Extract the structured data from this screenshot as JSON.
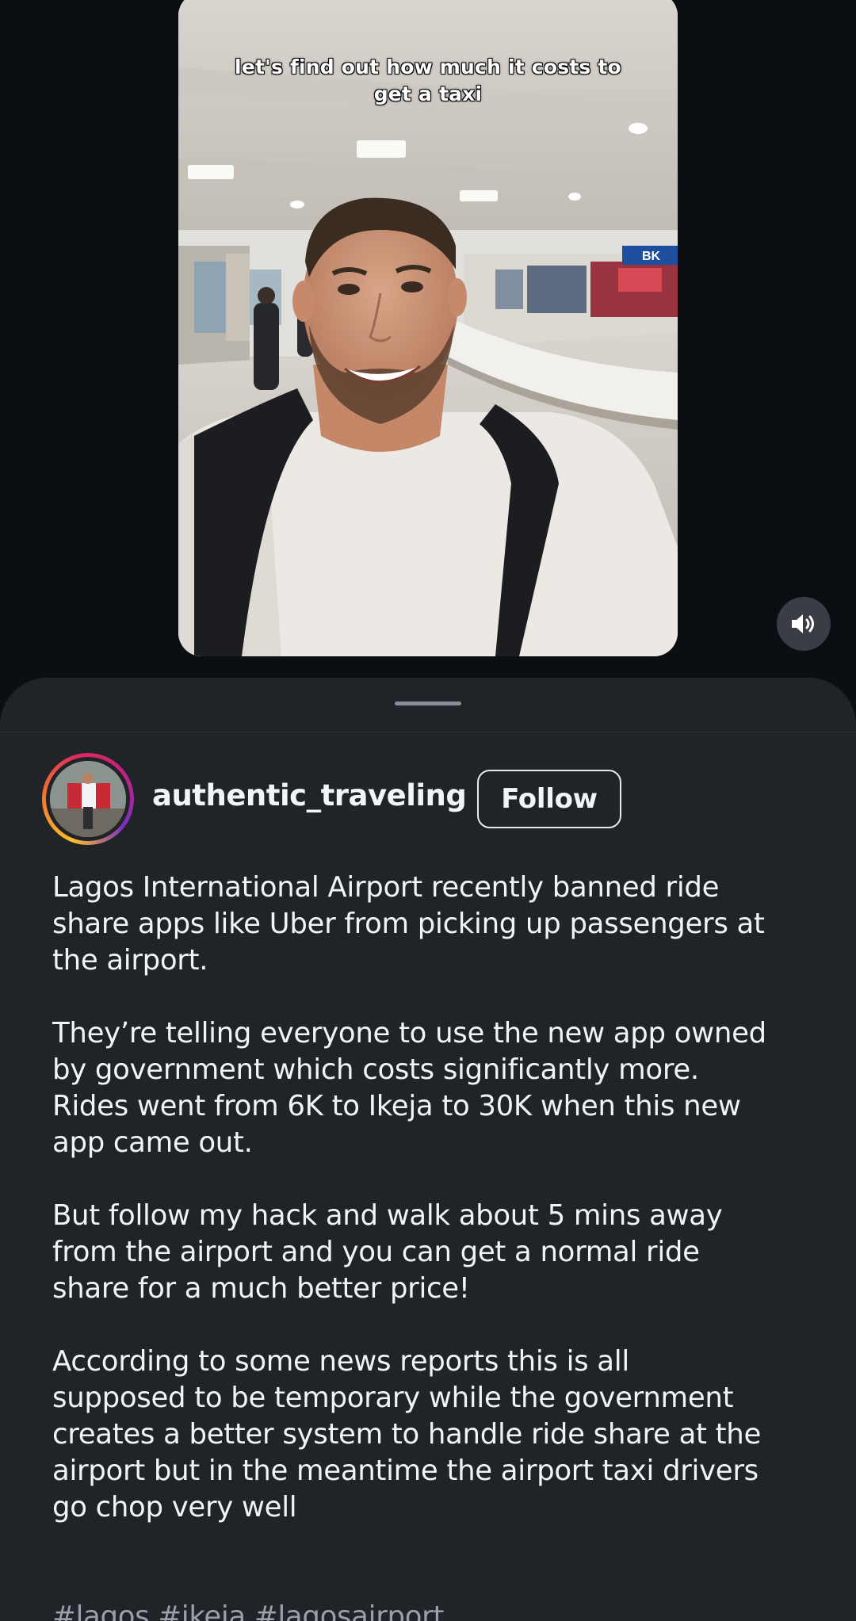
{
  "video": {
    "caption_line1": "let's find out how much it costs to",
    "caption_line2": "get a taxi",
    "sign_text": "BK"
  },
  "controls": {
    "volume_icon": "speaker-volume-icon"
  },
  "post": {
    "username": "authentic_traveling",
    "follow_label": "Follow",
    "paragraphs": [
      "Lagos International Airport recently banned ride\nshare apps like Uber from picking up passengers at\nthe airport.",
      "They’re telling everyone to use the new app owned\nby government which costs significantly more.\nRides went from 6K to Ikeja to 30K when this new\napp came out.",
      "But follow my hack and walk about 5 mins away\nfrom the airport and you can get a normal ride\nshare for a much better price!",
      "According to some news reports this is all\nsupposed to be temporary while the government\ncreates a better system to handle ride share at the\nairport but in the meantime the airport taxi drivers\ngo chop very well"
    ],
    "hashtags": [
      "#lagos",
      "#ikeja",
      "#lagosairport"
    ]
  },
  "colors": {
    "background": "#0b0e13",
    "sheet": "#202328",
    "text": "#f2f3f5",
    "hashtag": "#9aa0a8"
  }
}
